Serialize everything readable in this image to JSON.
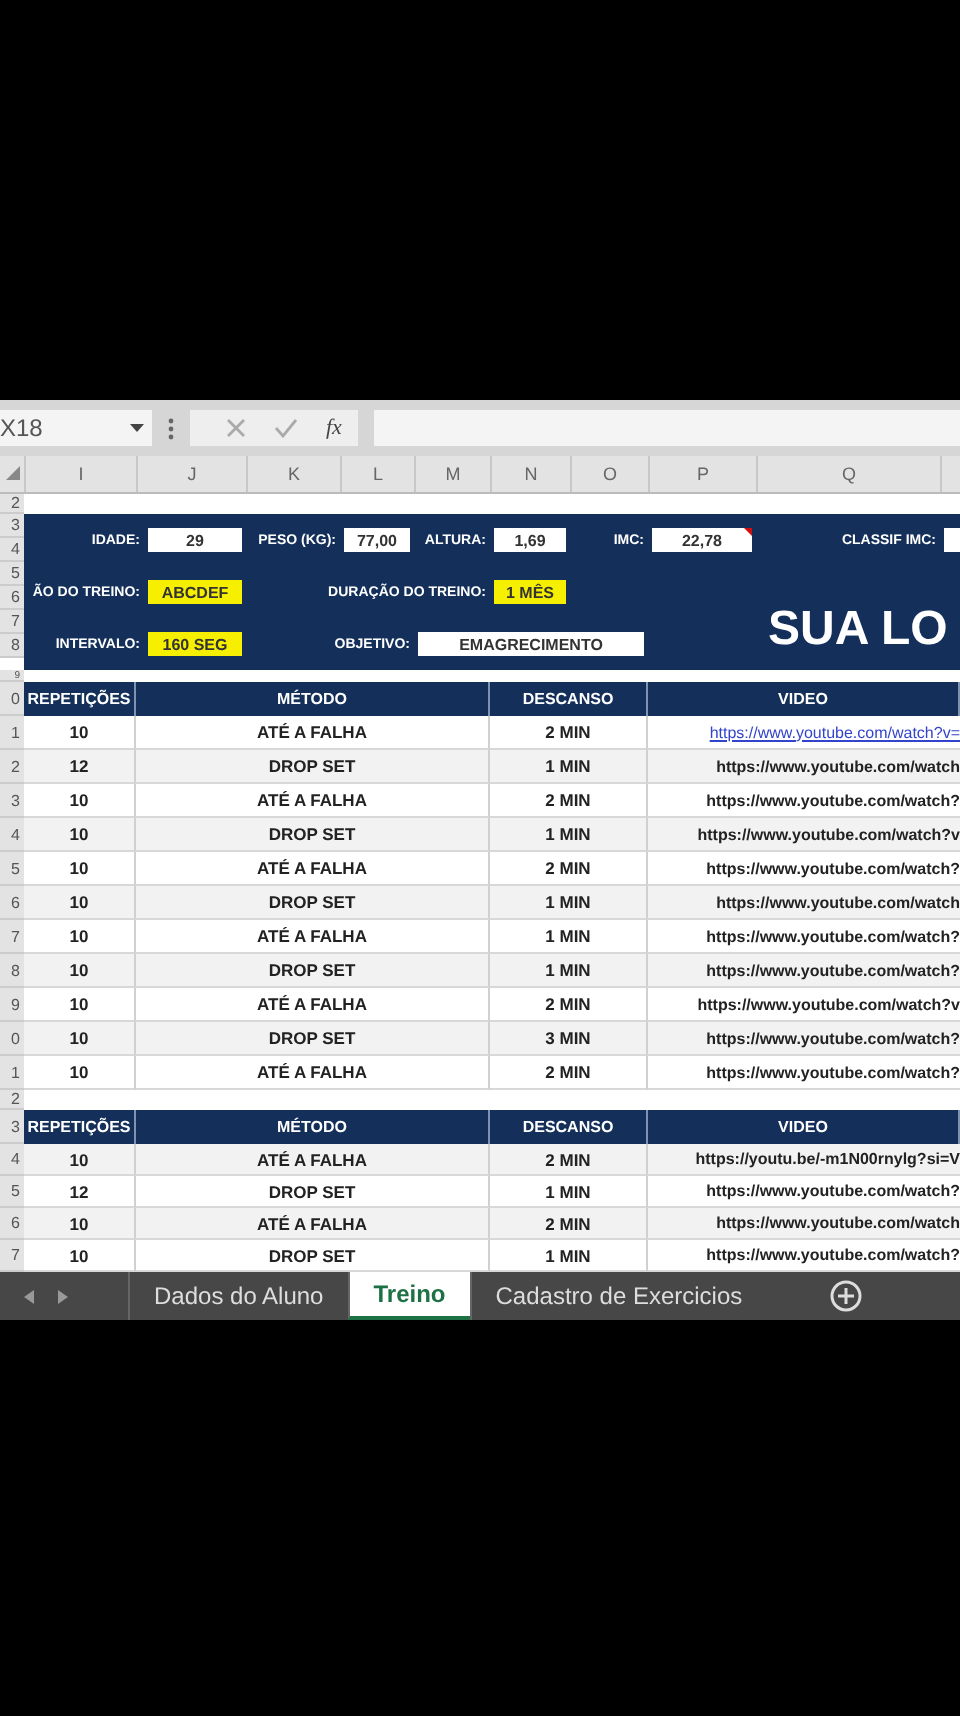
{
  "formula_bar": {
    "name_box": "X18",
    "function_label": "fx"
  },
  "column_headers": [
    "I",
    "J",
    "K",
    "L",
    "M",
    "N",
    "O",
    "P",
    "Q"
  ],
  "top_row": {
    "row_number": "2"
  },
  "header_panel": {
    "row_numbers": [
      "3",
      "4",
      "5",
      "6",
      "7",
      "8"
    ],
    "lines": [
      [
        {
          "kind": "label",
          "text": "IDADE:"
        },
        {
          "kind": "value",
          "text": "29"
        },
        {
          "kind": "label",
          "text": "PESO (KG):"
        },
        {
          "kind": "value",
          "text": "77,00"
        },
        {
          "kind": "label",
          "text": "ALTURA:"
        },
        {
          "kind": "value",
          "text": "1,69"
        },
        {
          "kind": "label",
          "text": "IMC:"
        },
        {
          "kind": "value",
          "text": "22,78",
          "comment": true
        },
        {
          "kind": "label",
          "text": "CLASSIF IMC:"
        },
        {
          "kind": "value"
        }
      ],
      [
        {
          "kind": "label",
          "text": "ÃO DO TREINO:"
        },
        {
          "kind": "highlight",
          "text": "ABCDEF"
        },
        {
          "kind": "label",
          "text": "DURAÇÃO DO TREINO:"
        },
        {
          "kind": "highlight",
          "text": "1 MÊS"
        }
      ],
      [
        {
          "kind": "label",
          "text": "INTERVALO:"
        },
        {
          "kind": "highlight",
          "text": "160 SEG"
        },
        {
          "kind": "label",
          "text": "OBJETIVO:"
        },
        {
          "kind": "value",
          "text": "EMAGRECIMENTO"
        }
      ]
    ],
    "banner": "SUA LO"
  },
  "gap_row_number": "9",
  "tables": [
    {
      "columns": [
        "REPETIÇÕES",
        "MÉTODO",
        "DESCANSO",
        "VIDEO"
      ],
      "header_row_number": "0",
      "rows": [
        {
          "row_number": "1",
          "cells": [
            "10",
            "ATÉ A FALHA",
            "2 MIN",
            "https://www.youtube.com/watch?v="
          ],
          "link_style": true
        },
        {
          "row_number": "2",
          "cells": [
            "12",
            "DROP SET",
            "1 MIN",
            "https://www.youtube.com/watch"
          ],
          "link_style": false
        },
        {
          "row_number": "3",
          "cells": [
            "10",
            "ATÉ A FALHA",
            "2 MIN",
            "https://www.youtube.com/watch?"
          ],
          "link_style": false
        },
        {
          "row_number": "4",
          "cells": [
            "10",
            "DROP SET",
            "1 MIN",
            "https://www.youtube.com/watch?v"
          ],
          "link_style": false
        },
        {
          "row_number": "5",
          "cells": [
            "10",
            "ATÉ A FALHA",
            "2 MIN",
            "https://www.youtube.com/watch?"
          ],
          "link_style": false
        },
        {
          "row_number": "6",
          "cells": [
            "10",
            "DROP SET",
            "1 MIN",
            "https://www.youtube.com/watch"
          ],
          "link_style": false
        },
        {
          "row_number": "7",
          "cells": [
            "10",
            "ATÉ A FALHA",
            "1 MIN",
            "https://www.youtube.com/watch?"
          ],
          "link_style": false
        },
        {
          "row_number": "8",
          "cells": [
            "10",
            "DROP SET",
            "1 MIN",
            "https://www.youtube.com/watch?"
          ],
          "link_style": false
        },
        {
          "row_number": "9",
          "cells": [
            "10",
            "ATÉ A FALHA",
            "2 MIN",
            "https://www.youtube.com/watch?v"
          ],
          "link_style": false
        },
        {
          "row_number": "0",
          "cells": [
            "10",
            "DROP SET",
            "3 MIN",
            "https://www.youtube.com/watch?"
          ],
          "link_style": false
        },
        {
          "row_number": "1",
          "cells": [
            "10",
            "ATÉ A FALHA",
            "2 MIN",
            "https://www.youtube.com/watch?"
          ],
          "link_style": false
        }
      ],
      "after_row_number": "2"
    },
    {
      "columns": [
        "REPETIÇÕES",
        "MÉTODO",
        "DESCANSO",
        "VIDEO"
      ],
      "header_row_number": "3",
      "rows": [
        {
          "row_number": "4",
          "cells": [
            "10",
            "ATÉ A FALHA",
            "2 MIN",
            "https://youtu.be/-m1N00rnylg?si=V"
          ],
          "link_style": false
        },
        {
          "row_number": "5",
          "cells": [
            "12",
            "DROP SET",
            "1 MIN",
            "https://www.youtube.com/watch?"
          ],
          "link_style": false
        },
        {
          "row_number": "6",
          "cells": [
            "10",
            "ATÉ A FALHA",
            "2 MIN",
            "https://www.youtube.com/watch"
          ],
          "link_style": false
        },
        {
          "row_number": "7",
          "cells": [
            "10",
            "DROP SET",
            "1 MIN",
            "https://www.youtube.com/watch?"
          ],
          "link_style": false
        }
      ]
    }
  ],
  "sheet_tabs": [
    {
      "label": "Dados do Aluno",
      "selected": false
    },
    {
      "label": "Treino",
      "selected": true
    },
    {
      "label": "Cadastro de Exercicios",
      "selected": false
    }
  ]
}
